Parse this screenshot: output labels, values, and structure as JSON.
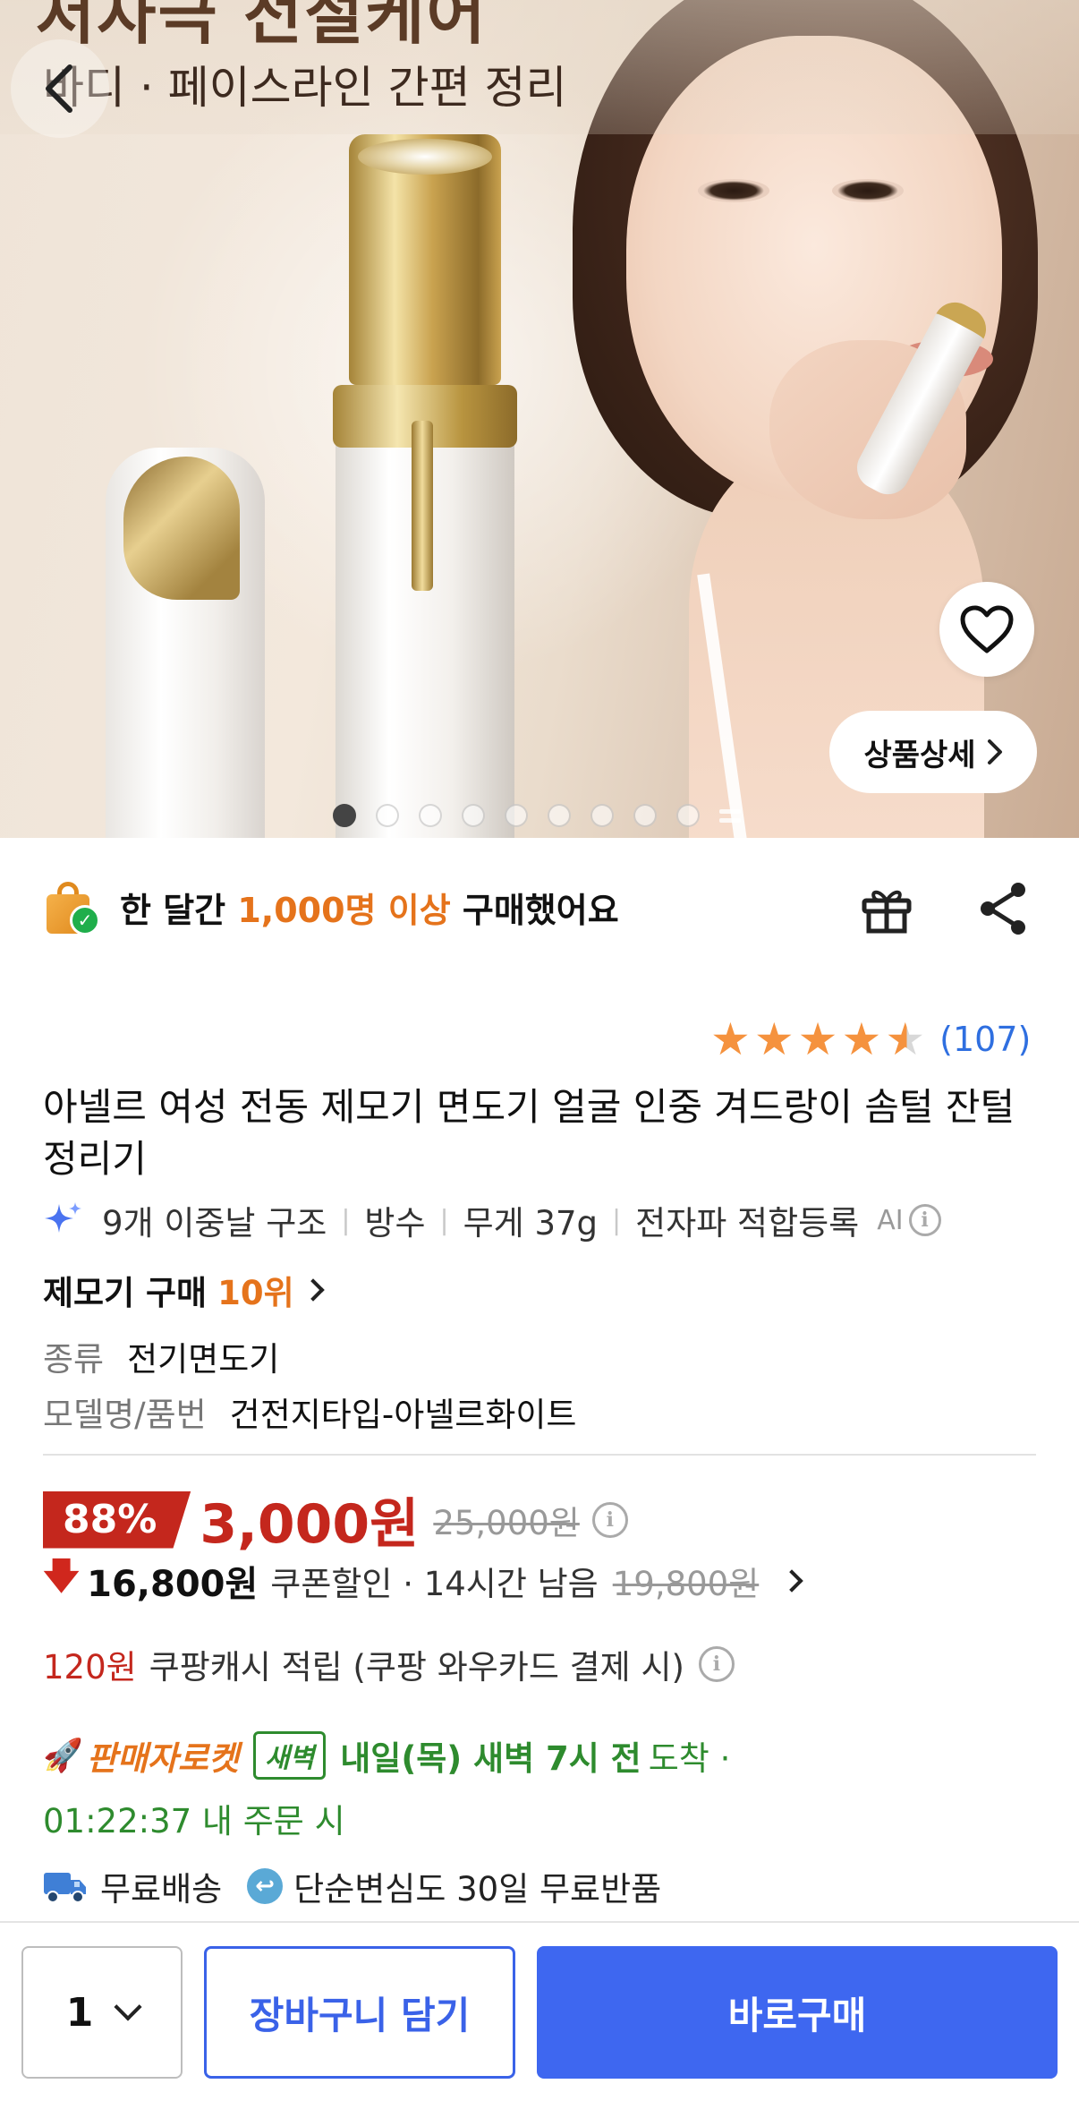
{
  "hero": {
    "banner_title": "저자극 전절케어",
    "banner_subtitle": "바디 · 페이스라인 간편 정리",
    "detail_button": "상품상세",
    "carousel_dots": 9
  },
  "purchase_strip": {
    "prefix": "한 달간 ",
    "highlight": "1,000명 이상",
    "suffix": " 구매했어요"
  },
  "rating": {
    "stars": 4.5,
    "count": "(107)"
  },
  "product": {
    "title": "아넬르 여성 전동 제모기 면도기 얼굴 인중 겨드랑이 솜털 잔털정리기",
    "features": [
      "9개 이중날 구조",
      "방수",
      "무게 37g",
      "전자파 적합등록"
    ],
    "ai_label": "AI",
    "rank_label": "제모기 구매",
    "rank_value": "10위",
    "specs": [
      {
        "key": "종류",
        "value": "전기면도기"
      },
      {
        "key": "모델명/품번",
        "value": "건전지타입-아넬르화이트"
      }
    ]
  },
  "price": {
    "discount": "88%",
    "sale_price": "3,000원",
    "original_price": "25,000원",
    "coupon_price": "16,800원",
    "coupon_text": "쿠폰할인 · 14시간 남음",
    "coupon_original": "19,800원",
    "cash_amount": "120원",
    "cash_text": "쿠팡캐시 적립 (쿠팡 와우카드 결제 시)"
  },
  "delivery": {
    "rocket_name": "판매자로켓",
    "dawn_badge": "새벽",
    "arrival_bold": "내일(목) 새벽 7시 전",
    "arrival_text": "도착 ·",
    "countdown": "01:22:37 내 주문 시",
    "free_shipping": "무료배송",
    "free_return": "단순변심도 30일 무료반품"
  },
  "bottom_bar": {
    "quantity": "1",
    "cart_button": "장바구니 담기",
    "buy_button": "바로구매"
  },
  "colors": {
    "accent_blue": "#3e67f0",
    "price_red": "#c4271d",
    "highlight_orange": "#e5731b",
    "delivery_green": "#2e8b2e",
    "star_orange": "#f5923e"
  }
}
